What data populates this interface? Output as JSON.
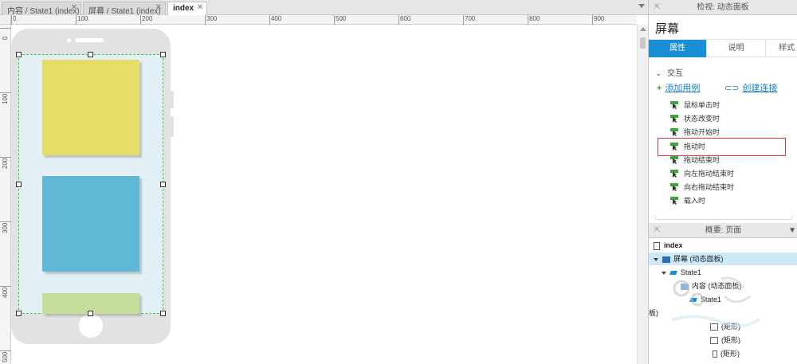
{
  "tabs": [
    {
      "label": "内容 / State1 (index)",
      "close": "✕"
    },
    {
      "label": "屏幕 / State1 (index)",
      "close": "✕"
    },
    {
      "label": "index",
      "close": "✕"
    }
  ],
  "ruler": {
    "h_ticks": [
      "0",
      "100",
      "200",
      "300",
      "400",
      "500",
      "600",
      "700",
      "800",
      "900"
    ],
    "v_ticks": [
      "0",
      "100",
      "200",
      "300",
      "400",
      "500"
    ]
  },
  "canvas": {
    "card_colors": [
      "#e6dd66",
      "#5fb8d6",
      "#c7de9a"
    ],
    "selection_color": "#39d039"
  },
  "inspector": {
    "header": "检视: 动态面板",
    "title": "屏幕",
    "tabs": [
      "属性",
      "说明",
      "样式"
    ],
    "section_label": "交互",
    "add_case": "添加用例",
    "create_link": "创建连接",
    "events": [
      "鼠标单击时",
      "状态改变时",
      "拖动开始时",
      "拖动时",
      "拖动结束时",
      "向左拖动结束时",
      "向右拖动结束时",
      "载入时"
    ],
    "highlighted_event": "拖动时",
    "accent": "#1a8fd6"
  },
  "outline": {
    "header": "概要: 页面",
    "items": [
      {
        "label": "index"
      },
      {
        "label": "屏幕 (动态面板)"
      },
      {
        "label": "State1"
      },
      {
        "label": "内容 (动态面板)"
      },
      {
        "label": "State1"
      },
      {
        "label": "(矩形)"
      },
      {
        "label": "(矩形)"
      },
      {
        "label": "(矩形)"
      }
    ],
    "cut_label": "板)"
  }
}
